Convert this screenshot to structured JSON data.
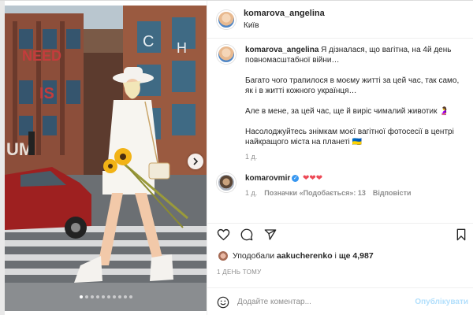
{
  "post": {
    "author": "komarova_angelina",
    "location": "Київ",
    "image_alt_icon": "photo-post",
    "carousel": {
      "total": 10,
      "active": 1
    }
  },
  "caption": {
    "author": "komarova_angelina",
    "p1": "Я дізналася, що вагітна, на 4й день повномасштабної війни…",
    "p2": "Багато чого трапилося в моєму житті за цей час, так само, як і в житті кожного українця…",
    "p3": "Але в мене, за цей час, ще й виріс чималий животик 🤰",
    "p4": "Насолоджуйтесь знімкам моєї вагітної фотосесії в центрі найкращого міста на планеті 🇺🇦",
    "time": "1 д."
  },
  "comment": {
    "author": "komarovmir",
    "text": "❤❤❤",
    "time": "1 д.",
    "likes_label": "Позначки «Подобається»: 13",
    "reply_label": "Відповісти"
  },
  "likes": {
    "prefix": "Уподобали",
    "user": "aakucherenko",
    "middle": "і",
    "count": "ще 4,987"
  },
  "post_date": "1 ДЕНЬ ТОМУ",
  "add_comment": {
    "placeholder": "Додайте коментар...",
    "publish_label": "Опублікувати"
  },
  "colors": {
    "accent": "#3897f0",
    "heart": "#ed4956",
    "muted": "#8e8e8e"
  }
}
